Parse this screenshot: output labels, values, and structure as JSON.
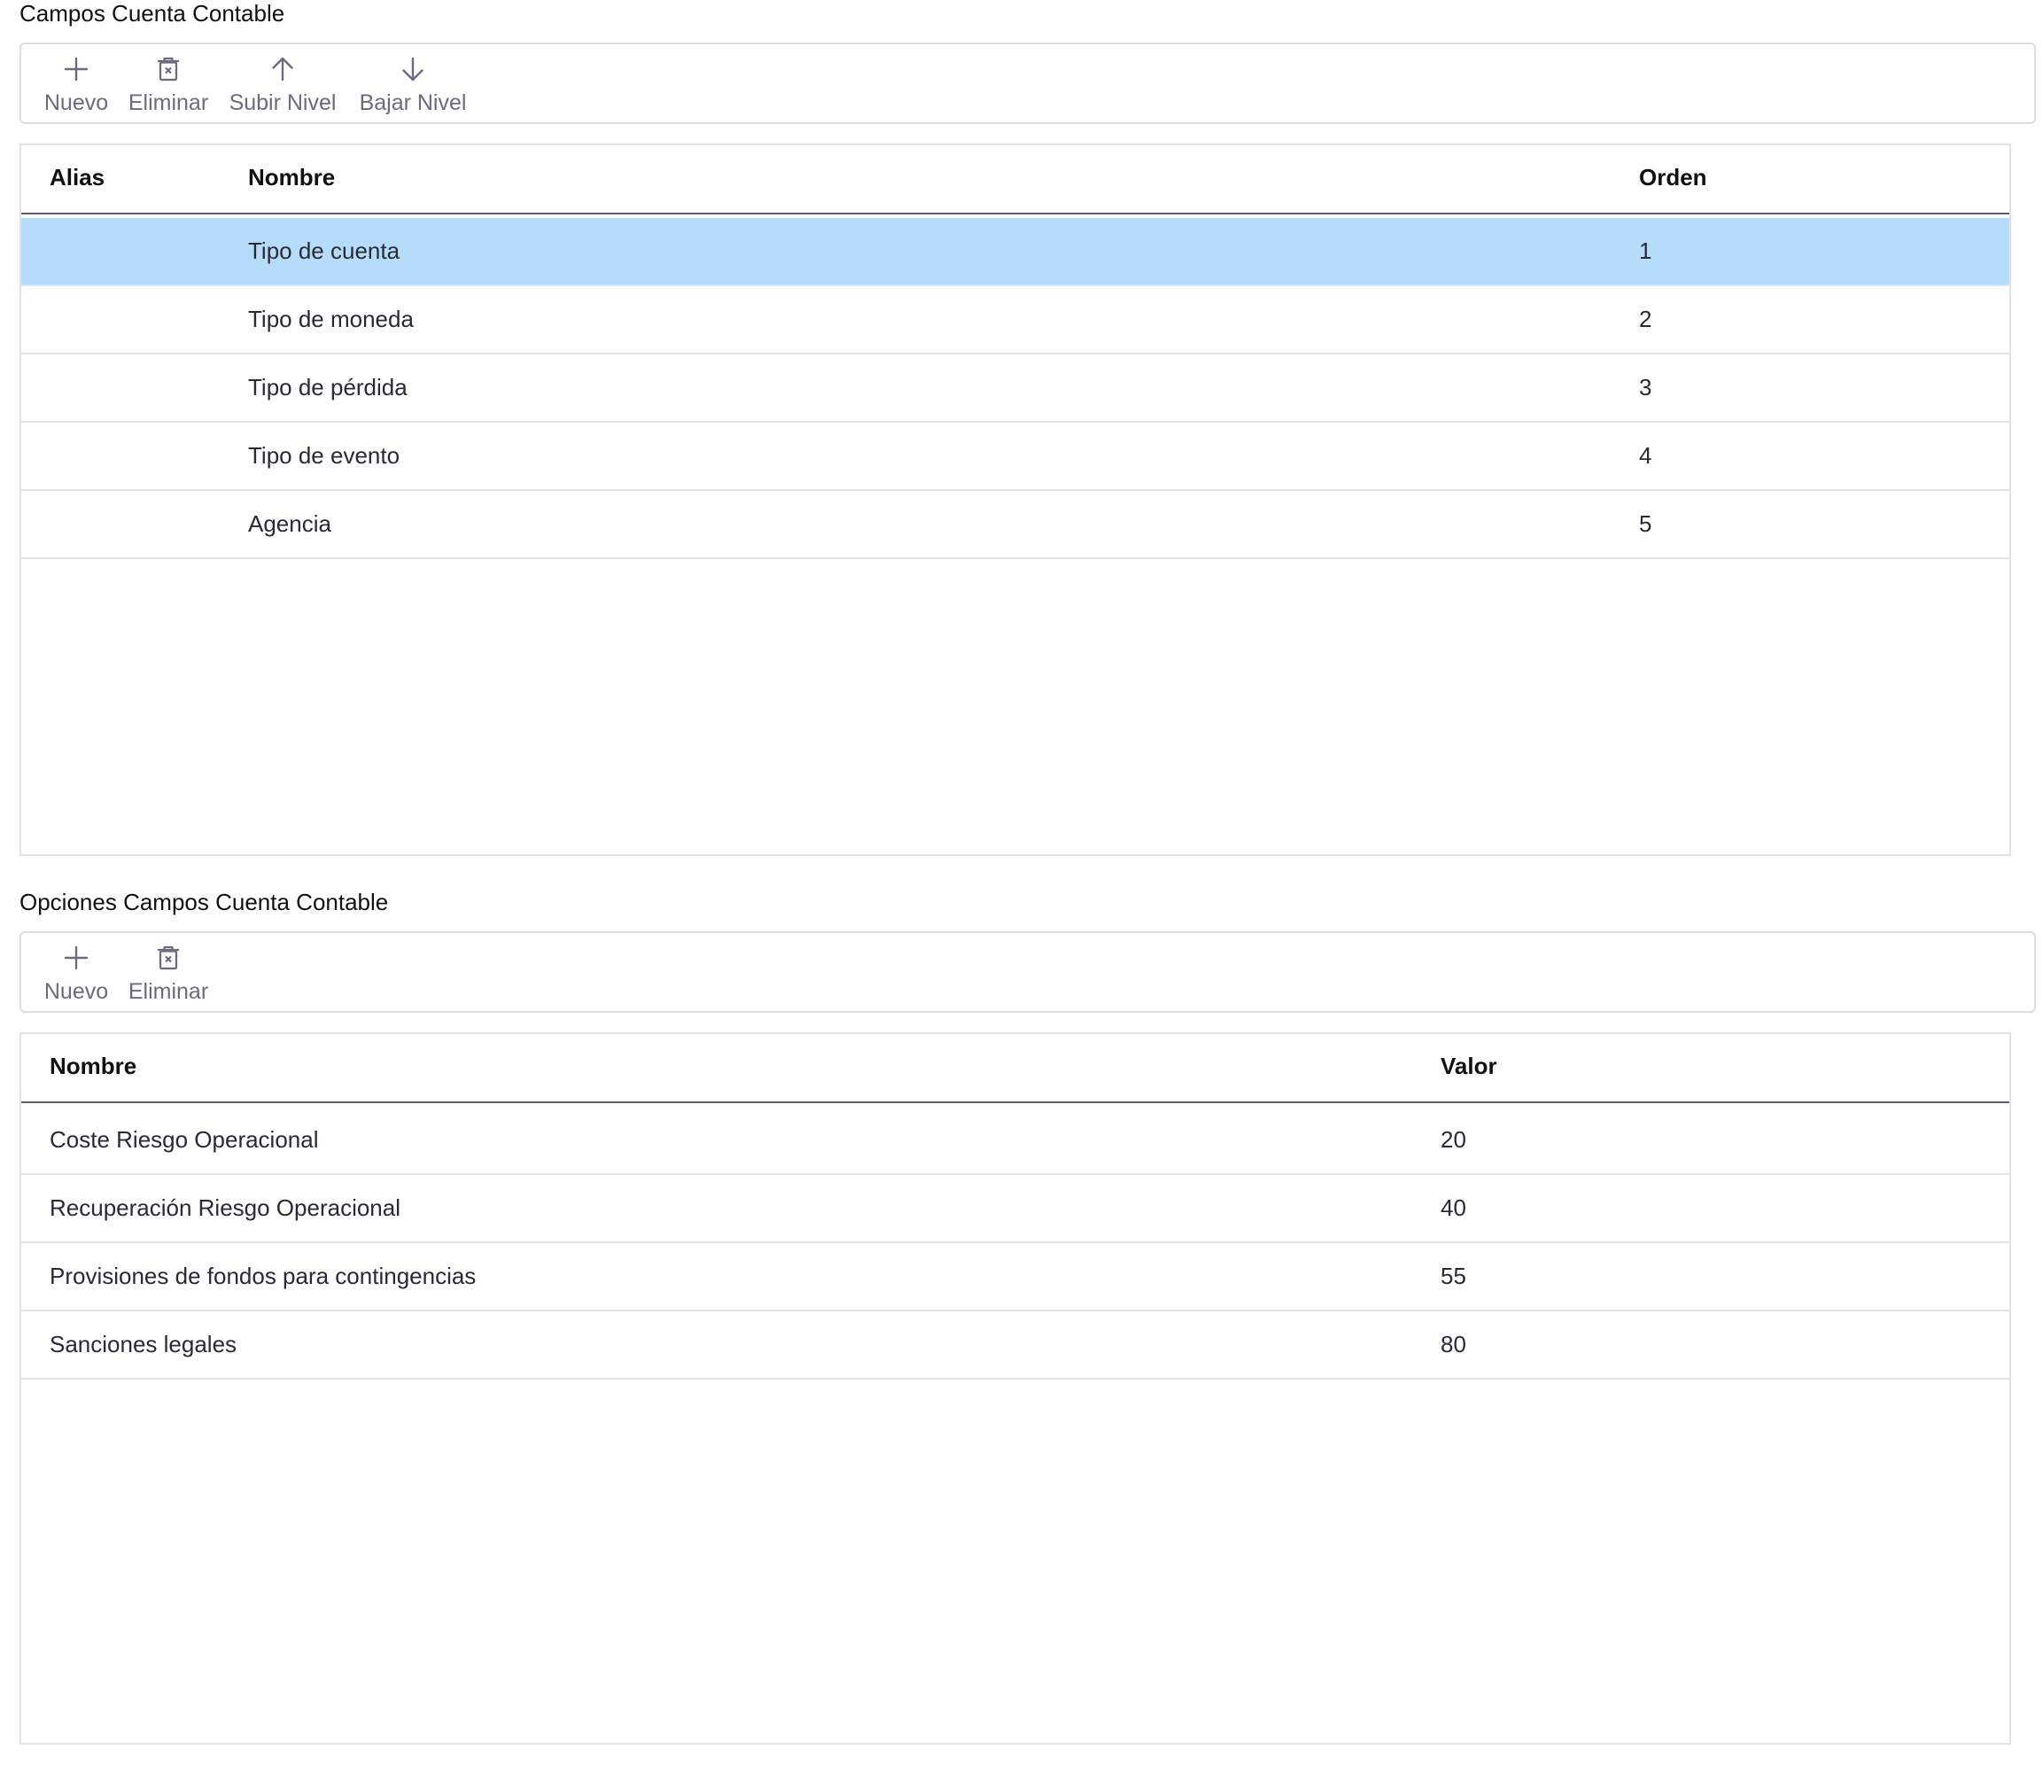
{
  "section1": {
    "title": "Campos Cuenta Contable",
    "toolbar": {
      "new_label": "Nuevo",
      "delete_label": "Eliminar",
      "up_label": "Subir Nivel",
      "down_label": "Bajar Nivel"
    },
    "columns": {
      "alias": "Alias",
      "nombre": "Nombre",
      "orden": "Orden"
    },
    "rows": [
      {
        "alias": "",
        "nombre": "Tipo de cuenta",
        "orden": "1",
        "selected": true
      },
      {
        "alias": "",
        "nombre": "Tipo de moneda",
        "orden": "2"
      },
      {
        "alias": "",
        "nombre": "Tipo de pérdida",
        "orden": "3"
      },
      {
        "alias": "",
        "nombre": "Tipo de evento",
        "orden": "4"
      },
      {
        "alias": "",
        "nombre": "Agencia",
        "orden": "5"
      }
    ]
  },
  "section2": {
    "title": "Opciones Campos Cuenta Contable",
    "toolbar": {
      "new_label": "Nuevo",
      "delete_label": "Eliminar"
    },
    "columns": {
      "nombre": "Nombre",
      "valor": "Valor"
    },
    "rows": [
      {
        "nombre": "Coste Riesgo Operacional",
        "valor": "20"
      },
      {
        "nombre": "Recuperación Riesgo Operacional",
        "valor": "40"
      },
      {
        "nombre": "Provisiones de fondos para contingencias",
        "valor": "55"
      },
      {
        "nombre": "Sanciones legales",
        "valor": "80"
      }
    ]
  },
  "icons": {
    "new": "plus-icon",
    "delete": "trash-icon",
    "up": "arrow-up-icon",
    "down": "arrow-down-icon"
  },
  "colors": {
    "selected_row": "#b6dcfb",
    "toolbar_text": "#6b6b80"
  }
}
